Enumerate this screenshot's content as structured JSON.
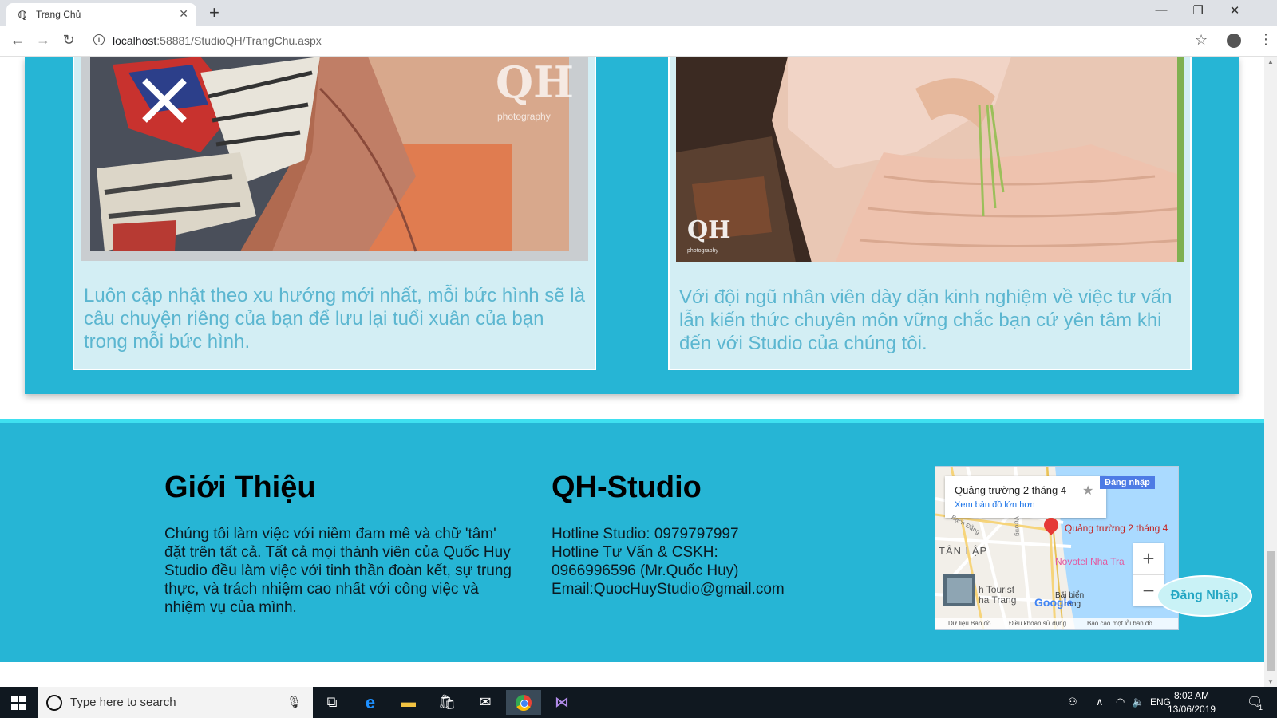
{
  "browser": {
    "tab_title": "Trang Chủ",
    "tab_close": "✕",
    "new_tab": "+",
    "url_host": "localhost",
    "url_rest": ":58881/StudioQH/TrangChu.aspx",
    "window_controls": [
      "—",
      "❐",
      "✕"
    ]
  },
  "cards": [
    {
      "text": "Luôn cập nhật theo xu hướng mới nhất, mỗi bức hình sẽ là câu chuyện riêng của bạn để lưu lại tuổi xuân của bạn trong mỗi bức hình.",
      "watermark": "QH",
      "watermark_sub": "photography"
    },
    {
      "text": "Với đội ngũ nhân viên dày dặn kinh nghiệm về việc tư vấn lẫn kiến thức chuyên môn vững chắc bạn cứ yên tâm khi đến với Studio của chúng tôi.",
      "watermark": "QH",
      "watermark_sub": "photography"
    }
  ],
  "footer": {
    "about": {
      "heading": "Giới Thiệu",
      "text": "Chúng tôi làm việc với niềm đam mê và chữ 'tâm' đặt trên tất cả. Tất cả mọi thành viên của Quốc Huy Studio đều làm việc với tinh thần đoàn kết, sự trung thực, và trách nhiệm cao nhất với công việc và nhiệm vụ của mình."
    },
    "studio": {
      "heading": "QH-Studio",
      "hotline": "Hotline Studio: 0979797997",
      "consult_label": "Hotline Tư Vấn & CSKH:",
      "consult_number": "0966996596 (Mr.Quốc Huy)",
      "email": "Email:QuocHuyStudio@gmail.com"
    },
    "map": {
      "place_title": "Quảng trường 2 tháng 4",
      "view_larger": "Xem bản đồ lớn hơn",
      "sign_in": "Đăng nhập",
      "pin_label": "Quảng trường 2 tháng 4",
      "district": "TÂN LẬP",
      "street1": "Bạch Đằng",
      "street2": "Vương",
      "hotel": "Novotel Nha Tra",
      "tourist1": "h Tourist",
      "tourist2": "ha Trang",
      "beach1": "Bãi biển",
      "beach2": "rang",
      "google": "Google",
      "footer_items": [
        "Dữ liệu Bản đồ",
        "Điều khoản sử dụng",
        "Báo cáo một lỗi bản đồ"
      ],
      "zoom_in": "+",
      "zoom_out": "−"
    }
  },
  "login_button": "Đăng Nhập",
  "taskbar": {
    "search_placeholder": "Type here to search",
    "lang": "ENG",
    "time": "8:02 AM",
    "date": "13/06/2019",
    "notif_count": "1"
  },
  "colors": {
    "accent": "#26b5d5",
    "card_bg": "#d3eef4",
    "card_text": "#5bb6d0",
    "footer_border": "#3fe0f0"
  }
}
